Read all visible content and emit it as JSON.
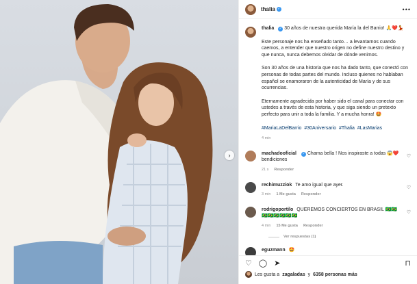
{
  "post": {
    "username": "thalia",
    "verified": true,
    "more_icon": "more-horizontal-icon"
  },
  "caption": {
    "username": "thalia",
    "intro": "30 años de nuestra querida María la del Barrio! 🙏❤️💃",
    "para1": "Este personaje nos ha enseñado tanto… a levantarnos cuando caemos, a entender que nuestro origen no define nuestro destino y que nunca, nunca debemos olvidar de dónde venimos.",
    "para2": "Son 30 años de una historia que nos ha dado tanto, que conectó con personas de todas partes del mundo. Incluso quienes no hablaban español se enamoraron de la autenticidad de María y de sus ocurrencias.",
    "para3": "Eternamente agradecida por haber sido el canal para conectar con ustedes a través de esta historia, y que siga siendo un pretexto perfecto para unir a toda la familia. Y a mucha honra! 🤩",
    "hashtags": [
      "#MariaLaDelBarrio",
      "#30Aniversario",
      "#Thalia",
      "#LasMarias"
    ],
    "time": "4 min"
  },
  "comments": [
    {
      "username": "machadooficial",
      "text": "Chama bella ! Nos inspiraste a todas 😱❤️ bendiciones",
      "time": "21 s",
      "likes": "",
      "reply_label": "Responder",
      "avatar_color": "#b07c5a"
    },
    {
      "username": "rechimuzziok",
      "text": "Te amo igual que ayer.",
      "time": "3 min",
      "likes": "1 Me gusta",
      "reply_label": "Responder",
      "avatar_color": "#4a4a4a"
    },
    {
      "username": "rodrigoportilo",
      "text": "QUEREMOS CONCIERTOS EN BRASIL 🇧🇷🇧🇷🇧🇷🇧🇷🇧🇷🇧🇷🇧🇷🇧🇷",
      "time": "4 min",
      "likes": "15 Me gusta",
      "reply_label": "Responder",
      "avatar_color": "#6b5a4d",
      "view_replies": "Ver respuestas (1)"
    },
    {
      "username": "eguzmann",
      "text": "🤩",
      "time": "",
      "likes": "",
      "reply_label": "",
      "avatar_color": "#3c3c3c"
    }
  ],
  "footer": {
    "likes_text_prefix": "Les gusta a ",
    "likes_user": "zagaladas",
    "likes_text_mid": " y ",
    "likes_count": "6358 personas más"
  },
  "icons": {
    "heart": "heart-icon",
    "comment": "comment-icon",
    "share": "share-icon",
    "save": "bookmark-icon",
    "next": "chevron-right-icon"
  }
}
